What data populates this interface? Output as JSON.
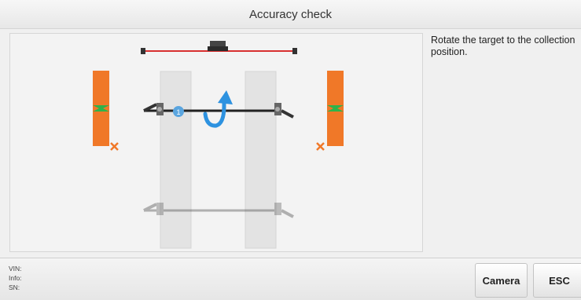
{
  "window": {
    "title": "Accuracy check"
  },
  "instruction": "Rotate the target to the collection position.",
  "footer": {
    "vin_label": "VIN:",
    "info_label": "Info:",
    "sn_label": "SN:"
  },
  "buttons": {
    "camera": "Camera",
    "esc": "ESC"
  },
  "diagram": {
    "step_number": "1"
  },
  "colors": {
    "camera_bar": "#d83030",
    "side_target": "#f07828",
    "green_mark": "#2fb34a",
    "x_mark": "#f07828",
    "rotate_arrow": "#2d92e0",
    "step_badge": "#5aa5df"
  },
  "icons": [
    "rotate-arrow-icon",
    "step-badge-icon",
    "x-mark-icon"
  ]
}
